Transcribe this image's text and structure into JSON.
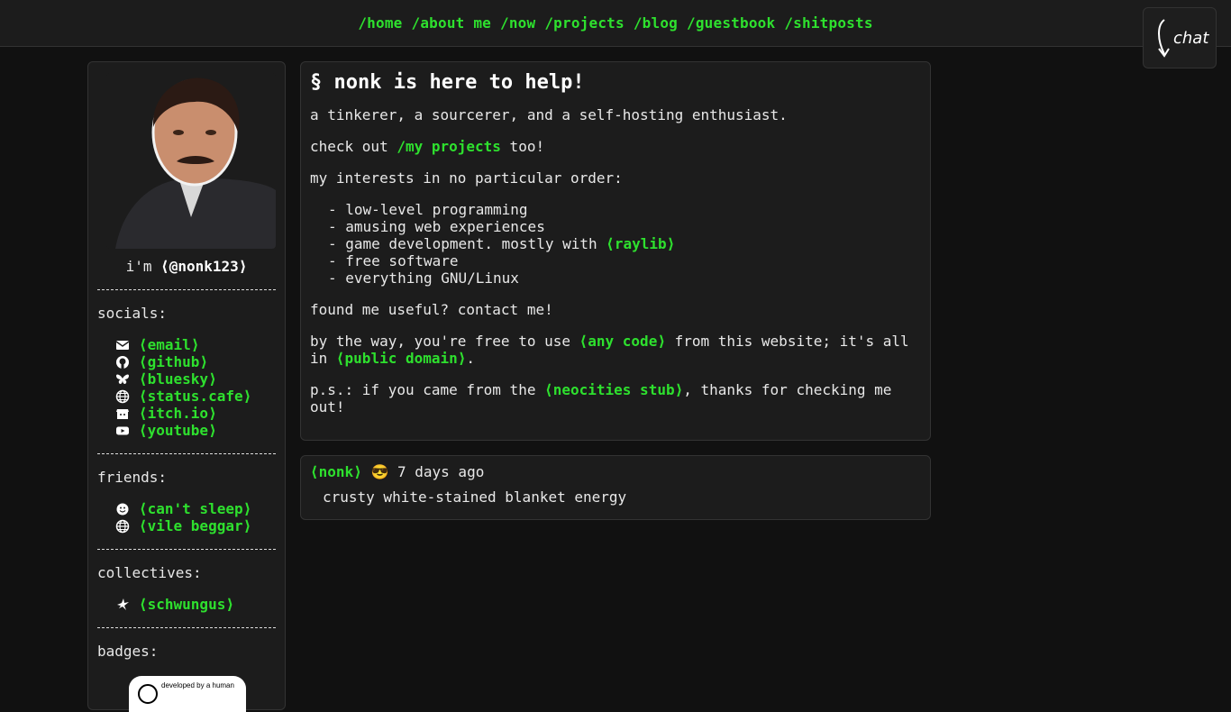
{
  "nav": {
    "links": [
      "/home",
      "/about me",
      "/now",
      "/projects",
      "/blog",
      "/guestbook",
      "/shitposts"
    ]
  },
  "chat": {
    "label": "chat"
  },
  "sidebar": {
    "caption_prefix": "i'm ",
    "handle": "⟨@nonk123⟩",
    "socials_title": "socials:",
    "socials": [
      {
        "label": "⟨email⟩",
        "icon": "envelope-icon"
      },
      {
        "label": "⟨github⟩",
        "icon": "github-icon"
      },
      {
        "label": "⟨bluesky⟩",
        "icon": "butterfly-icon"
      },
      {
        "label": "⟨status.cafe⟩",
        "icon": "globe-icon"
      },
      {
        "label": "⟨itch.io⟩",
        "icon": "itch-icon"
      },
      {
        "label": "⟨youtube⟩",
        "icon": "youtube-icon"
      }
    ],
    "friends_title": "friends:",
    "friends": [
      {
        "label": "⟨can't sleep⟩",
        "icon": "smiley-icon"
      },
      {
        "label": "⟨vile beggar⟩",
        "icon": "globe-icon"
      }
    ],
    "collectives_title": "collectives:",
    "collectives": [
      {
        "label": "⟨schwungus⟩",
        "icon": "bird-icon"
      }
    ],
    "badges_title": "badges:",
    "badge_text": "developed by a human"
  },
  "main": {
    "title": "§ nonk is here to help!",
    "intro": "a tinkerer, a sourcerer, and a self-hosting enthusiast.",
    "check_pre": "check out ",
    "check_link": "/my projects",
    "check_post": " too!",
    "interests_title": "my interests in no particular order:",
    "interests": [
      {
        "pre": "- low-level programming",
        "link": "",
        "post": ""
      },
      {
        "pre": "- amusing web experiences",
        "link": "",
        "post": ""
      },
      {
        "pre": "- game development. mostly with ",
        "link": "⟨raylib⟩",
        "post": ""
      },
      {
        "pre": "- free software",
        "link": "",
        "post": ""
      },
      {
        "pre": "- everything GNU/Linux",
        "link": "",
        "post": ""
      }
    ],
    "contact": "found me useful? contact me!",
    "license_pre": "by the way, you're free to use ",
    "license_link1": "⟨any code⟩",
    "license_mid": " from this website; it's all in ",
    "license_link2": "⟨public domain⟩",
    "license_post": ".",
    "ps_pre": "p.s.: if you came from the ",
    "ps_link": "⟨neocities stub⟩",
    "ps_post": ", thanks for checking me out!"
  },
  "status": {
    "author": "⟨nonk⟩",
    "emoji": "😎",
    "time": "7 days ago",
    "text": "crusty white-stained blanket energy"
  }
}
